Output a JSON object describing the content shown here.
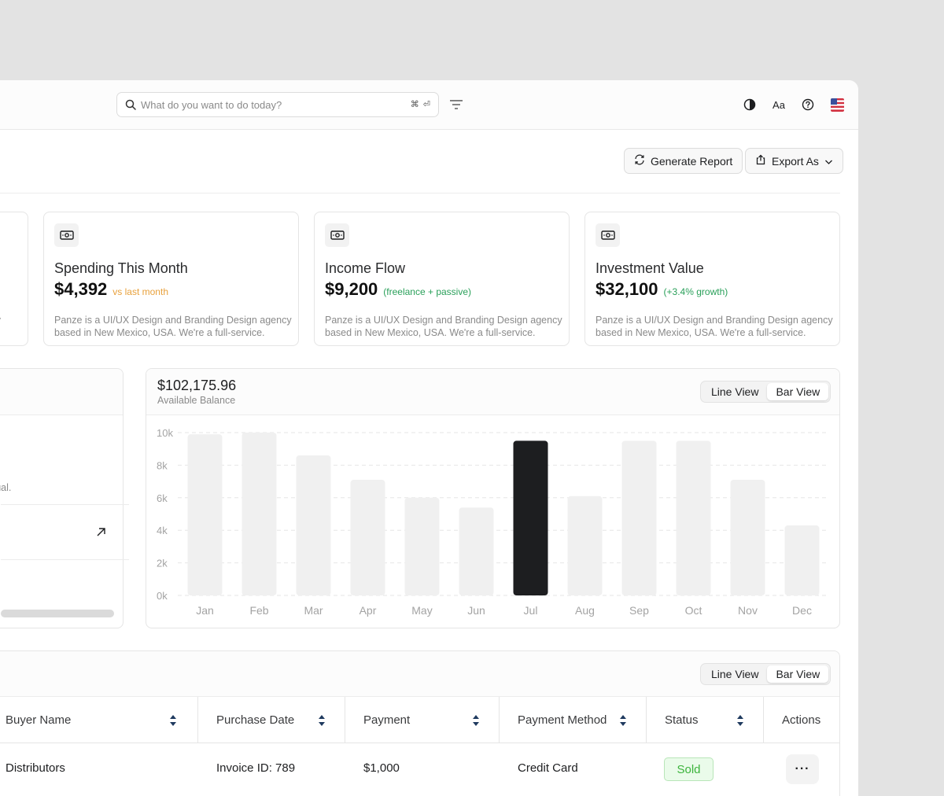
{
  "topbar": {
    "search_placeholder": "What do you want to do today?",
    "shortcut_cmd": "⌘",
    "shortcut_key": "⏎",
    "font_label": "Aa"
  },
  "actions": {
    "generate_report": "Generate Report",
    "export_as": "Export As"
  },
  "cards": [
    {
      "desc_partial": "ency"
    },
    {
      "title": "Spending This Month",
      "value": "$4,392",
      "note": "vs last month",
      "note_color": "#e8a13c",
      "desc": "Panze is a UI/UX Design and Branding Design agency based in New Mexico, USA. We're a full-service."
    },
    {
      "title": "Income Flow",
      "value": "$9,200",
      "note": "(freelance + passive)",
      "note_color": "#2aa05a",
      "desc": "Panze is a UI/UX Design and Branding Design agency based in New Mexico, USA. We're a full-service."
    },
    {
      "title": "Investment Value",
      "value": "$32,100",
      "note": "(+3.4% growth)",
      "note_color": "#2aa05a",
      "desc": "Panze is a UI/UX Design and Branding Design agency based in New Mexico, USA. We're a full-service."
    }
  ],
  "left_panel": {
    "text_partial": "usual."
  },
  "balance": {
    "amount": "$102,175.96",
    "label": "Available Balance"
  },
  "view_toggle": {
    "line": "Line View",
    "bar": "Bar View",
    "active": "bar"
  },
  "chart_data": {
    "type": "bar",
    "categories": [
      "Jan",
      "Feb",
      "Mar",
      "Apr",
      "May",
      "Jun",
      "Jul",
      "Aug",
      "Sep",
      "Oct",
      "Nov",
      "Dec"
    ],
    "values": [
      9900,
      10000,
      8600,
      7100,
      6000,
      5400,
      9500,
      6100,
      9500,
      9500,
      7100,
      4300
    ],
    "highlight": "Jul",
    "highlight_color": "#1d1e20",
    "bar_color": "#f0f0f0",
    "ylim": [
      0,
      10000
    ],
    "yticks": [
      "0k",
      "2k",
      "4k",
      "6k",
      "8k",
      "10k"
    ],
    "grid": true
  },
  "table": {
    "columns": [
      "Buyer Name",
      "Purchase Date",
      "Payment",
      "Payment Method",
      "Status",
      "Actions"
    ],
    "rows": [
      {
        "buyer": "Distributors",
        "purchase": "Invoice ID: 789",
        "payment": "$1,000",
        "method": "Credit Card",
        "status": "Sold"
      }
    ]
  }
}
